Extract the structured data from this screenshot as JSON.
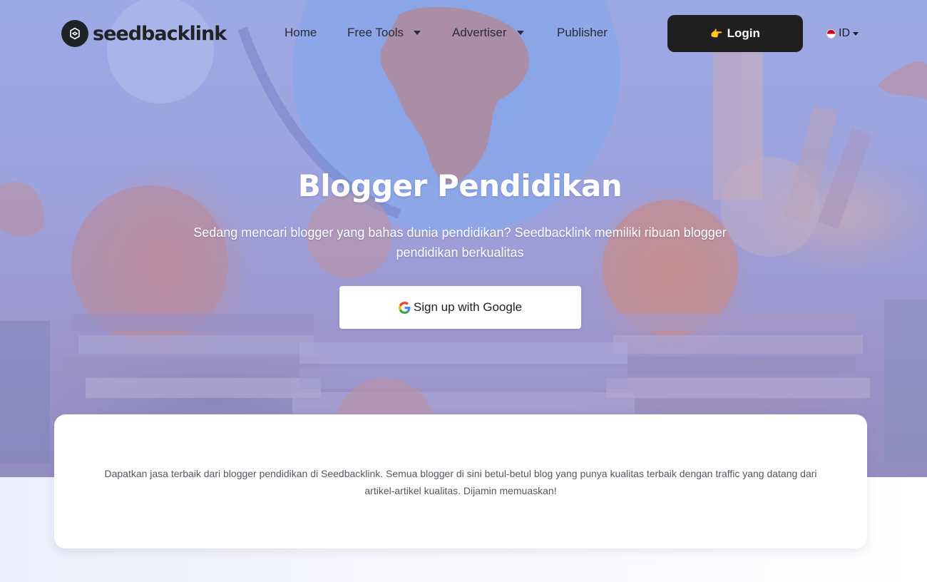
{
  "header": {
    "logo_text": "seedbacklink",
    "nav": [
      {
        "label": "Home",
        "has_dropdown": false
      },
      {
        "label": "Free Tools",
        "has_dropdown": true
      },
      {
        "label": "Advertiser",
        "has_dropdown": true
      },
      {
        "label": "Publisher",
        "has_dropdown": false
      }
    ],
    "login": {
      "label": "Login",
      "icon": "hand-pointing-icon"
    },
    "language": {
      "label": "ID",
      "icon": "indonesia-flag-icon"
    }
  },
  "hero": {
    "title": "Blogger Pendidikan",
    "subtitle": "Sedang mencari blogger yang bahas dunia pendidikan? Seedbacklink memiliki ribuan blogger pendidikan berkualitas",
    "cta_label": "Sign up with Google",
    "cta_icon": "google-icon"
  },
  "card": {
    "text": "Dapatkan jasa terbaik dari blogger pendidikan di Seedbacklink. Semua blogger di sini betul-betul blog yang punya kualitas terbaik dengan traffic yang datang dari artikel-artikel kualitas. Dijamin memuaskan!"
  },
  "colors": {
    "login_bg": "#1f1f1f",
    "hero_overlay": "#8c98e1",
    "text_dark": "#2a2b33",
    "card_text": "#555760"
  }
}
